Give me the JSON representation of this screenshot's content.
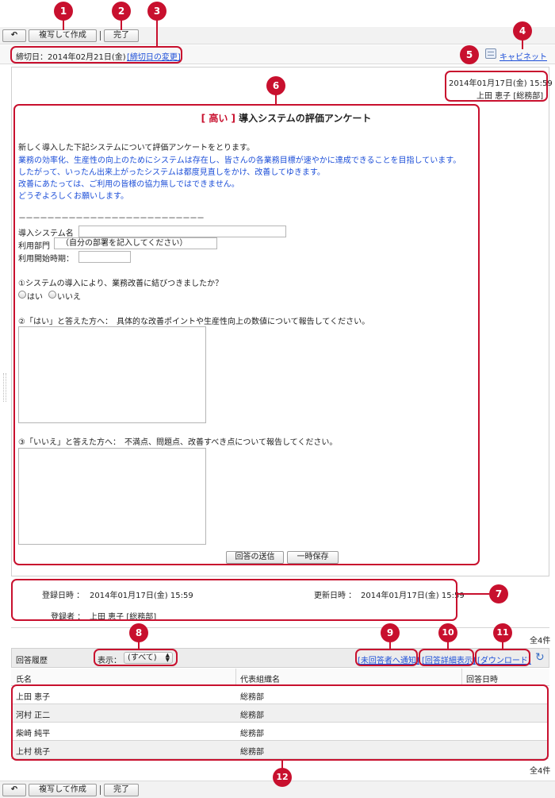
{
  "toolbar": {
    "back_label": "↶",
    "copy_label": "複写して作成",
    "done_label": "完了"
  },
  "deadline": {
    "text": "締切日：2014年02月21日(金)",
    "change_link": "[締切日の変更]"
  },
  "cabinet": {
    "label": "キャビネット",
    "icon": "cabinet-icon"
  },
  "meta": {
    "date": "2014年01月17日(金) 15:59",
    "author": "上田 恵子 [総務部]"
  },
  "survey": {
    "priority": "[ 高い ]",
    "title": "導入システムの評価アンケート",
    "intro": "新しく導入した下記システムについて評価アンケートをとります。",
    "blue_lines": [
      "業務の効率化、生産性の向上のためにシステムは存在し、皆さんの各業務目標が速やかに達成できることを目指しています。",
      "したがって、いったん出来上がったシステムは都度見直しをかけ、改善してゆきます。",
      "改善にあたっては、ご利用の皆様の協力無しではできません。",
      "どうぞよろしくお願いします。"
    ],
    "divider": "－－－－－－－－－－－－－－－－－－－－－－－－－－",
    "field_system_label": "導入システム名",
    "field_dept_label": "利用部門",
    "field_dept_value": "（自分の部署を記入してください）",
    "field_start_label": "利用開始時期：",
    "q1": "①システムの導入により、業務改善に結びつきましたか？",
    "q1_yes": "はい",
    "q1_no": "いいえ",
    "q2": "②「はい」と答えた方へ：　具体的な改善ポイントや生産性向上の数値について報告してください。",
    "q3": "③「いいえ」と答えた方へ：　不満点、問題点、改善すべき点について報告してください。",
    "submit_label": "回答の送信",
    "save_label": "一時保存"
  },
  "registration": {
    "created_label": "登録日時 ：",
    "created_value": "2014年01月17日(金) 15:59",
    "updated_label": "更新日時 ：",
    "updated_value": "2014年01月17日(金) 15:59",
    "registrant_label": "登録者 ：",
    "registrant_value": "上田 恵子 [総務部]"
  },
  "history": {
    "count_label": "全4件",
    "title": "回答履歴",
    "filter_label": "表示：",
    "filter_value": "(すべて)",
    "notify_link": "[未回答者へ通知]",
    "detail_link": "[回答詳細表示]",
    "download_link": "[ダウンロード]",
    "columns": [
      "氏名",
      "代表組織名",
      "回答日時"
    ],
    "rows": [
      {
        "name": "上田 恵子",
        "org": "総務部",
        "date": ""
      },
      {
        "name": "河村 正二",
        "org": "総務部",
        "date": ""
      },
      {
        "name": "柴崎 純平",
        "org": "総務部",
        "date": ""
      },
      {
        "name": "上村 桃子",
        "org": "総務部",
        "date": ""
      }
    ],
    "footer_count": "全4件"
  },
  "callouts": [
    "1",
    "2",
    "3",
    "4",
    "5",
    "6",
    "7",
    "8",
    "9",
    "10",
    "11",
    "12"
  ],
  "colors": {
    "callout": "#c8102e",
    "link": "#1d4fd8",
    "priority": "#c8102e"
  }
}
